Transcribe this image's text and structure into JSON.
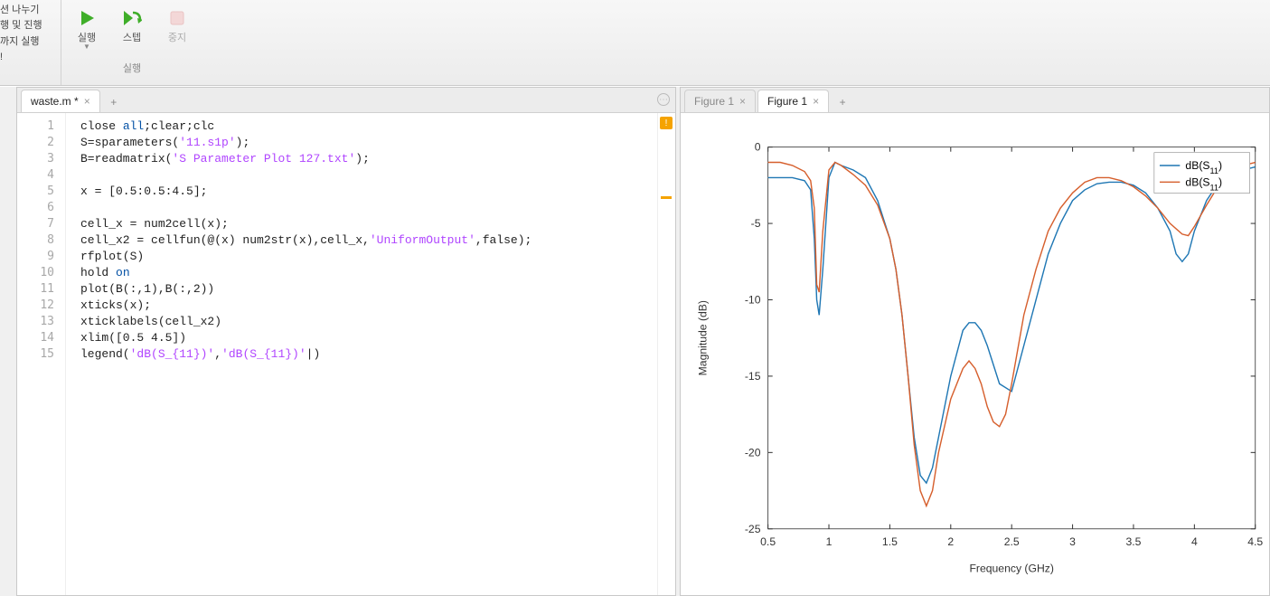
{
  "toolbar": {
    "left_lines": [
      "션 나누기",
      "행 및 진행",
      "까지 실행",
      "!"
    ],
    "run_label": "실행",
    "step_label": "스텝",
    "stop_label": "중지",
    "group_label": "실행"
  },
  "editor": {
    "file_tab": "waste.m *",
    "line_numbers": [
      "1",
      "2",
      "3",
      "4",
      "5",
      "6",
      "7",
      "8",
      "9",
      "10",
      "11",
      "12",
      "13",
      "14",
      "15"
    ],
    "code_lines": [
      {
        "segs": [
          {
            "t": "close ",
            "c": ""
          },
          {
            "t": "all",
            "c": "kw"
          },
          {
            "t": ";clear;clc",
            "c": ""
          }
        ]
      },
      {
        "segs": [
          {
            "t": "S=sparameters(",
            "c": ""
          },
          {
            "t": "'11.s1p'",
            "c": "str"
          },
          {
            "t": ");",
            "c": ""
          }
        ]
      },
      {
        "segs": [
          {
            "t": "B=readmatrix(",
            "c": ""
          },
          {
            "t": "'S Parameter Plot 127.txt'",
            "c": "str"
          },
          {
            "t": ");",
            "c": ""
          }
        ]
      },
      {
        "segs": [
          {
            "t": "",
            "c": ""
          }
        ]
      },
      {
        "segs": [
          {
            "t": "x = [0.5:0.5:4.5];",
            "c": ""
          }
        ]
      },
      {
        "segs": [
          {
            "t": "",
            "c": ""
          }
        ]
      },
      {
        "segs": [
          {
            "t": "cell_x = num2cell(x);",
            "c": ""
          }
        ]
      },
      {
        "segs": [
          {
            "t": "cell_x2 = cellfun(@(x) num2str(x),cell_x,",
            "c": ""
          },
          {
            "t": "'UniformOutput'",
            "c": "str"
          },
          {
            "t": ",false);",
            "c": ""
          }
        ]
      },
      {
        "segs": [
          {
            "t": "rfplot(S)",
            "c": ""
          }
        ]
      },
      {
        "segs": [
          {
            "t": "hold ",
            "c": ""
          },
          {
            "t": "on",
            "c": "kw"
          }
        ]
      },
      {
        "segs": [
          {
            "t": "plot(B(:,1),B(:,2))",
            "c": ""
          }
        ]
      },
      {
        "segs": [
          {
            "t": "xticks(x);",
            "c": ""
          }
        ]
      },
      {
        "segs": [
          {
            "t": "xticklabels(cell_x2)",
            "c": ""
          }
        ]
      },
      {
        "segs": [
          {
            "t": "xlim([0.5 4.5])",
            "c": ""
          }
        ]
      },
      {
        "segs": [
          {
            "t": "legend(",
            "c": ""
          },
          {
            "t": "'dB(S_{11})'",
            "c": "str"
          },
          {
            "t": ",",
            "c": ""
          },
          {
            "t": "'dB(S_{11})'",
            "c": "str"
          },
          {
            "t": "|)",
            "c": ""
          }
        ]
      }
    ]
  },
  "figure": {
    "tab_inactive": "Figure 1",
    "tab_active": "Figure 1",
    "xlabel": "Frequency (GHz)",
    "ylabel": "Magnitude (dB)",
    "legend": [
      "dB(S",
      "11",
      ")",
      "dB(S",
      "11",
      ")"
    ]
  },
  "chart_data": {
    "type": "line",
    "xlabel": "Frequency (GHz)",
    "ylabel": "Magnitude (dB)",
    "xlim": [
      0.5,
      4.5
    ],
    "ylim": [
      -25,
      0
    ],
    "xticks": [
      0.5,
      1,
      1.5,
      2,
      2.5,
      3,
      3.5,
      4,
      4.5
    ],
    "yticks": [
      0,
      -5,
      -10,
      -15,
      -20,
      -25
    ],
    "legend_position": "top-right",
    "series": [
      {
        "name": "dB(S11) blue",
        "color": "#1f77b4",
        "x": [
          0.5,
          0.6,
          0.7,
          0.8,
          0.85,
          0.88,
          0.9,
          0.92,
          0.95,
          1.0,
          1.05,
          1.1,
          1.2,
          1.3,
          1.4,
          1.5,
          1.55,
          1.6,
          1.65,
          1.7,
          1.75,
          1.8,
          1.85,
          1.9,
          2.0,
          2.1,
          2.15,
          2.2,
          2.25,
          2.3,
          2.4,
          2.5,
          2.6,
          2.7,
          2.8,
          2.9,
          3.0,
          3.1,
          3.2,
          3.3,
          3.4,
          3.5,
          3.6,
          3.7,
          3.8,
          3.85,
          3.9,
          3.95,
          4.0,
          4.1,
          4.2,
          4.3,
          4.4,
          4.5
        ],
        "y": [
          -2,
          -2,
          -2,
          -2.2,
          -2.8,
          -6,
          -10,
          -11,
          -8,
          -2,
          -1,
          -1.2,
          -1.5,
          -2,
          -3.5,
          -6,
          -8,
          -11,
          -15,
          -19,
          -21.5,
          -22,
          -21,
          -19,
          -15,
          -12,
          -11.5,
          -11.5,
          -12,
          -13,
          -15.5,
          -16,
          -13,
          -10,
          -7,
          -5,
          -3.5,
          -2.8,
          -2.4,
          -2.3,
          -2.3,
          -2.5,
          -3,
          -4,
          -5.5,
          -7,
          -7.5,
          -7,
          -5.5,
          -3.5,
          -2.3,
          -1.8,
          -1.5,
          -1.3
        ]
      },
      {
        "name": "dB(S11) orange",
        "color": "#d65f2d",
        "x": [
          0.5,
          0.6,
          0.7,
          0.8,
          0.85,
          0.88,
          0.9,
          0.92,
          0.95,
          1.0,
          1.05,
          1.1,
          1.2,
          1.3,
          1.4,
          1.5,
          1.55,
          1.6,
          1.65,
          1.7,
          1.75,
          1.8,
          1.85,
          1.9,
          2.0,
          2.1,
          2.15,
          2.2,
          2.25,
          2.3,
          2.35,
          2.4,
          2.45,
          2.5,
          2.6,
          2.7,
          2.8,
          2.9,
          3.0,
          3.1,
          3.2,
          3.3,
          3.4,
          3.5,
          3.6,
          3.7,
          3.8,
          3.9,
          3.95,
          4.0,
          4.1,
          4.2,
          4.3,
          4.4,
          4.5
        ],
        "y": [
          -1,
          -1,
          -1.2,
          -1.6,
          -2.2,
          -4,
          -9,
          -9.5,
          -5.5,
          -1.5,
          -1,
          -1.2,
          -1.8,
          -2.5,
          -3.8,
          -6,
          -8,
          -11,
          -15,
          -19.5,
          -22.5,
          -23.5,
          -22.5,
          -20,
          -16.5,
          -14.5,
          -14,
          -14.5,
          -15.5,
          -17,
          -18,
          -18.3,
          -17.5,
          -15.5,
          -11,
          -8,
          -5.5,
          -4,
          -3,
          -2.3,
          -2,
          -2,
          -2.2,
          -2.6,
          -3.2,
          -4,
          -5,
          -5.7,
          -5.8,
          -5.2,
          -3.8,
          -2.5,
          -1.7,
          -1.2,
          -1
        ]
      }
    ]
  }
}
